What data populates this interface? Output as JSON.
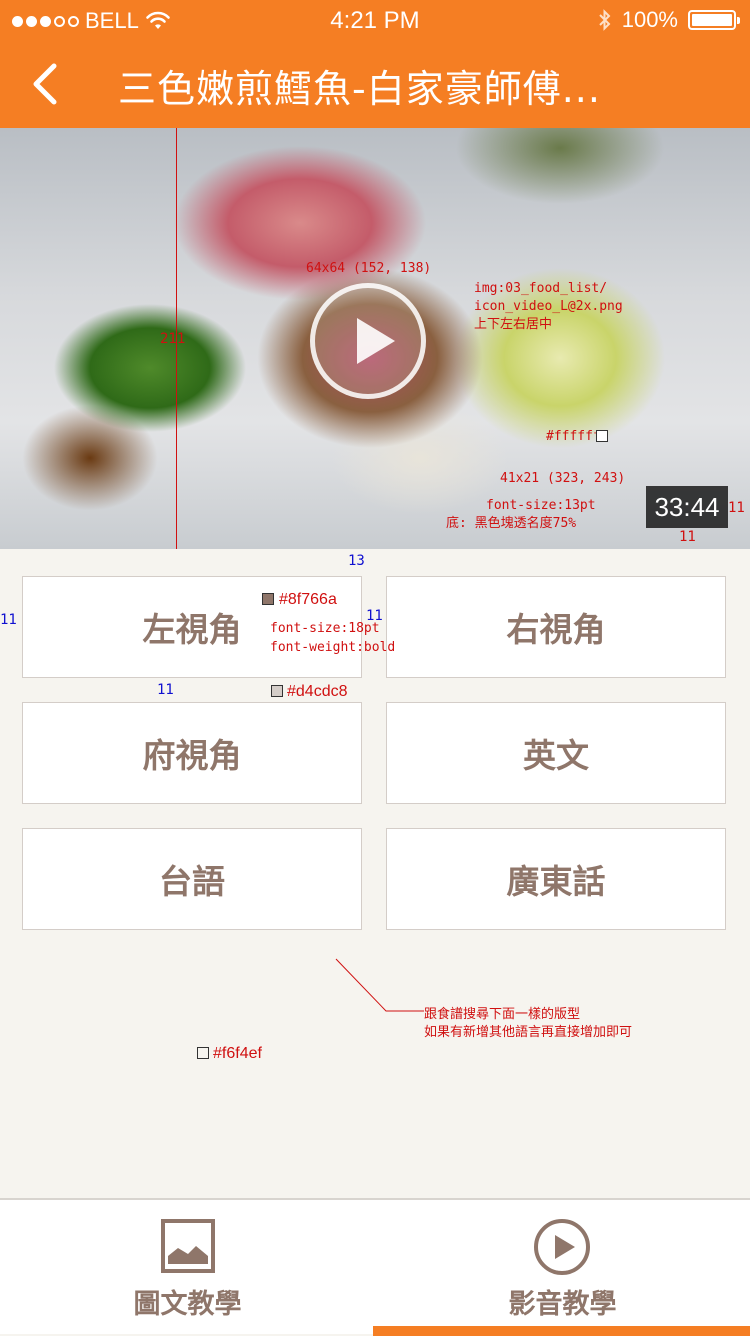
{
  "status_bar": {
    "carrier": "BELL",
    "time": "4:21 PM",
    "battery": "100%",
    "battery_level": 1.0,
    "signal_filled": 3,
    "signal_total": 5
  },
  "nav": {
    "title": "三色嫩煎鱈魚-白家豪師傅..."
  },
  "video": {
    "duration": "33:44"
  },
  "annotations": {
    "hero_height": "211",
    "play_size": "64x64 (152, 138)",
    "play_img_line1": "img:03_food_list/",
    "play_img_line2": "icon_video_L@2x.png",
    "play_img_line3": "上下左右居中",
    "white": "#ffffff",
    "duration_size": "41x21 (323, 243)",
    "duration_font": "font-size:13pt",
    "duration_bg": "底: 黑色塊透名度75%",
    "right_margin": "11",
    "bottom_margin": "11",
    "top_gap": "13",
    "left_margin": "11",
    "mid_gap": "11",
    "button_height": "51",
    "text_color": "#8f766a",
    "font_size": "font-size:18pt",
    "font_weight": "font-weight:bold",
    "border_color": "#d4cdc8",
    "row_gap": "11",
    "note_line1": "跟食譜搜尋下面一樣的版型",
    "note_line2": "如果有新增其他語言再直接增加即可",
    "bg_color": "#f6f4ef"
  },
  "options": [
    {
      "label": "左視角"
    },
    {
      "label": "右視角"
    },
    {
      "label": "府視角"
    },
    {
      "label": "英文"
    },
    {
      "label": "台語"
    },
    {
      "label": "廣東話"
    }
  ],
  "tabs": [
    {
      "label": "圖文教學",
      "icon": "image-icon",
      "active": false
    },
    {
      "label": "影音教學",
      "icon": "play-circle-icon",
      "active": true
    }
  ],
  "colors": {
    "accent": "#f57e23",
    "button_text": "#8f766a",
    "button_border": "#d4cdc8",
    "background": "#f6f4ef",
    "annotation": "#d01010"
  }
}
